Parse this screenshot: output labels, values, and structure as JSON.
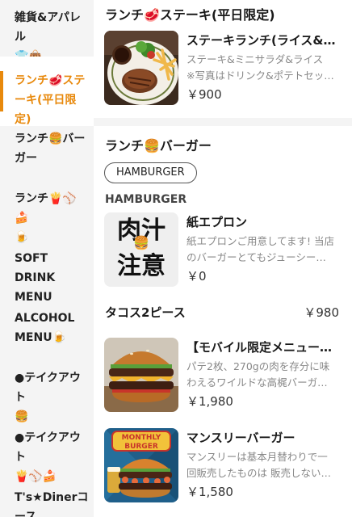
{
  "sidebar": {
    "items": [
      {
        "label": "雑貨&アパレル\n👕👜",
        "active": false
      },
      {
        "label": "ランチ🥩ステ\nーキ(平日限定)",
        "active": true
      },
      {
        "label": "ランチ🍔バー\nガー",
        "active": false
      },
      {
        "label": "ランチ🍟⚾🍰\n🍺",
        "active": false
      },
      {
        "label": "SOFT DRINK\nMENU",
        "active": false
      },
      {
        "label": "ALCOHOL\nMENU🍺",
        "active": false
      },
      {
        "label": "●テイクアウト\n🍔",
        "active": false
      },
      {
        "label": "●テイクアウト\n🍟⚾🍰",
        "active": false
      },
      {
        "label": "T's★Dinerコ\nース",
        "active": false
      }
    ]
  },
  "sections": {
    "steak": {
      "title": "ランチ🥩ステーキ(平日限定)",
      "items": [
        {
          "name": "ステーキランチ(ライス&…",
          "desc1": "ステーキ&ミニサラダ&ライス",
          "desc2": "※写真はドリンク&ポテトセッ…",
          "price": "￥900",
          "image": "steak-plate"
        }
      ]
    },
    "burger": {
      "title": "ランチ🍔バーガー",
      "tag": "HAMBURGER",
      "subheading": "HAMBURGER",
      "apron": {
        "name": "紙エプロン",
        "desc1": "紙エプロンご用意してます! 当店",
        "desc2": "のバーガーとてもジューシー…",
        "price": "￥0",
        "thumb_text_top": "肉汁",
        "thumb_text_bottom": "注意",
        "thumb_emoji": "🍔"
      },
      "tacos": {
        "name": "タコス2ピース",
        "price": "￥980"
      },
      "items": [
        {
          "name": "【モバイル限定メニュー…",
          "desc1": "パテ2枚、270gの肉を存分に味",
          "desc2": "わえるワイルドな高梶バーガ…",
          "price": "￥1,980",
          "image": "double-burger"
        },
        {
          "name": "マンスリーバーガー",
          "desc1": "マンスリーは基本月替わりで一",
          "desc2": "回販売したものは 販売しない…",
          "price": "￥1,580",
          "image": "monthly-burger",
          "badge_line1": "MONTHLY",
          "badge_line2": "BURGER"
        }
      ]
    }
  },
  "colors": {
    "accent": "#e8890c",
    "sidebar_bg": "#f4f4f4",
    "text": "#1a1a1a",
    "muted": "#888888"
  }
}
